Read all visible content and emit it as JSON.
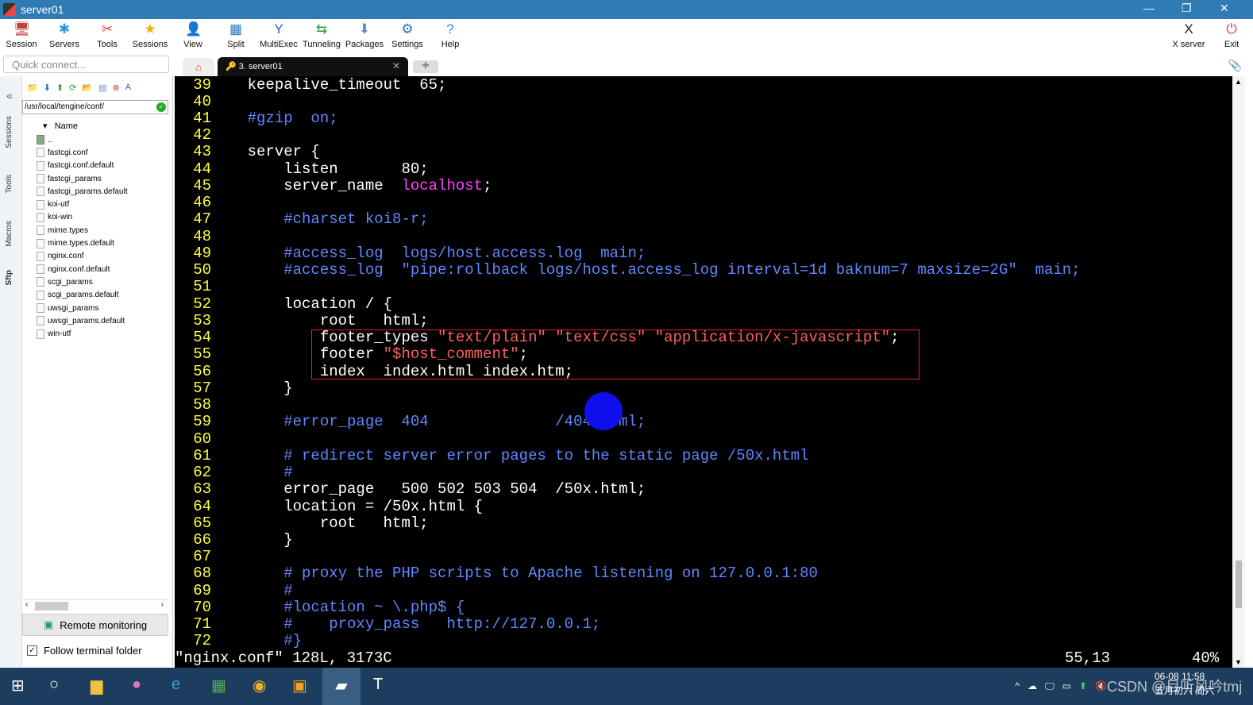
{
  "window": {
    "title": "server01"
  },
  "toolbar": {
    "items": [
      "Session",
      "Servers",
      "Tools",
      "Sessions",
      "View",
      "Split",
      "MultiExec",
      "Tunneling",
      "Packages",
      "Settings",
      "Help"
    ],
    "right": [
      "X server",
      "Exit"
    ]
  },
  "quick_connect": {
    "placeholder": "Quick connect..."
  },
  "tabs": {
    "active": "3. server01"
  },
  "side_tabs": [
    "Sessions",
    "Tools",
    "Macros",
    "Sftp"
  ],
  "sftp": {
    "path": "/usr/local/tengine/conf/",
    "column": "Name",
    "files": [
      "..",
      "fastcgi.conf",
      "fastcgi.conf.default",
      "fastcgi_params",
      "fastcgi_params.default",
      "koi-utf",
      "koi-win",
      "mime.types",
      "mime.types.default",
      "nginx.conf",
      "nginx.conf.default",
      "scgi_params",
      "scgi_params.default",
      "uwsgi_params",
      "uwsgi_params.default",
      "win-utf"
    ],
    "remote_monitoring": "Remote monitoring",
    "follow_folder": "Follow terminal folder"
  },
  "terminal": {
    "lines": [
      {
        "n": "39",
        "t": [
          [
            "    keepalive_timeout  65;",
            ""
          ]
        ]
      },
      {
        "n": "40",
        "t": []
      },
      {
        "n": "41",
        "t": [
          [
            "    #gzip  on;",
            "c"
          ]
        ]
      },
      {
        "n": "42",
        "t": []
      },
      {
        "n": "43",
        "t": [
          [
            "    server {",
            ""
          ]
        ]
      },
      {
        "n": "44",
        "t": [
          [
            "        listen       80;",
            ""
          ]
        ]
      },
      {
        "n": "45",
        "t": [
          [
            "        server_name  ",
            ""
          ],
          [
            "localhost",
            "m"
          ],
          [
            ";",
            ""
          ]
        ]
      },
      {
        "n": "46",
        "t": []
      },
      {
        "n": "47",
        "t": [
          [
            "        #charset koi8-r;",
            "c"
          ]
        ]
      },
      {
        "n": "48",
        "t": []
      },
      {
        "n": "49",
        "t": [
          [
            "        #access_log  logs/host.access.log  main;",
            "c"
          ]
        ]
      },
      {
        "n": "50",
        "t": [
          [
            "        #access_log  \"pipe:rollback logs/host.access_log interval=1d baknum=7 maxsize=2G\"  main;",
            "c"
          ]
        ]
      },
      {
        "n": "51",
        "t": []
      },
      {
        "n": "52",
        "t": [
          [
            "        location / {",
            ""
          ]
        ]
      },
      {
        "n": "53",
        "t": [
          [
            "            root   html;",
            ""
          ]
        ]
      },
      {
        "n": "54",
        "t": [
          [
            "            footer_types ",
            ""
          ],
          [
            "\"text/plain\" \"text/css\" \"application/x-javascript\"",
            "s"
          ],
          [
            ";",
            ""
          ]
        ]
      },
      {
        "n": "55",
        "t": [
          [
            "            footer ",
            ""
          ],
          [
            "\"$host_comment\"",
            "s"
          ],
          [
            ";",
            ""
          ]
        ]
      },
      {
        "n": "56",
        "t": [
          [
            "            index  index.html index.htm;",
            ""
          ]
        ]
      },
      {
        "n": "57",
        "t": [
          [
            "        }",
            ""
          ]
        ]
      },
      {
        "n": "58",
        "t": []
      },
      {
        "n": "59",
        "t": [
          [
            "        #error_page  404              /404.html;",
            "c"
          ]
        ]
      },
      {
        "n": "60",
        "t": []
      },
      {
        "n": "61",
        "t": [
          [
            "        # redirect server error pages to the static page /50x.html",
            "c"
          ]
        ]
      },
      {
        "n": "62",
        "t": [
          [
            "        #",
            "c"
          ]
        ]
      },
      {
        "n": "63",
        "t": [
          [
            "        error_page   500 502 503 504  /50x.html;",
            ""
          ]
        ]
      },
      {
        "n": "64",
        "t": [
          [
            "        location = /50x.html {",
            ""
          ]
        ]
      },
      {
        "n": "65",
        "t": [
          [
            "            root   html;",
            ""
          ]
        ]
      },
      {
        "n": "66",
        "t": [
          [
            "        }",
            ""
          ]
        ]
      },
      {
        "n": "67",
        "t": []
      },
      {
        "n": "68",
        "t": [
          [
            "        # proxy the PHP scripts to Apache listening on 127.0.0.1:80",
            "c"
          ]
        ]
      },
      {
        "n": "69",
        "t": [
          [
            "        #",
            "c"
          ]
        ]
      },
      {
        "n": "70",
        "t": [
          [
            "        #location ~ \\.php$ {",
            "c"
          ]
        ]
      },
      {
        "n": "71",
        "t": [
          [
            "        #    proxy_pass   http://127.0.0.1;",
            "c"
          ]
        ]
      },
      {
        "n": "72",
        "t": [
          [
            "        #}",
            "c"
          ]
        ]
      }
    ],
    "status_file": "\"nginx.conf\" 128L, 3173C",
    "status_pos": "55,13",
    "status_pct": "40%"
  },
  "taskbar": {
    "date": "06-08 11:58",
    "lunar": "五月初六 周六",
    "watermark": "CSDN @目听风吟tmj"
  }
}
